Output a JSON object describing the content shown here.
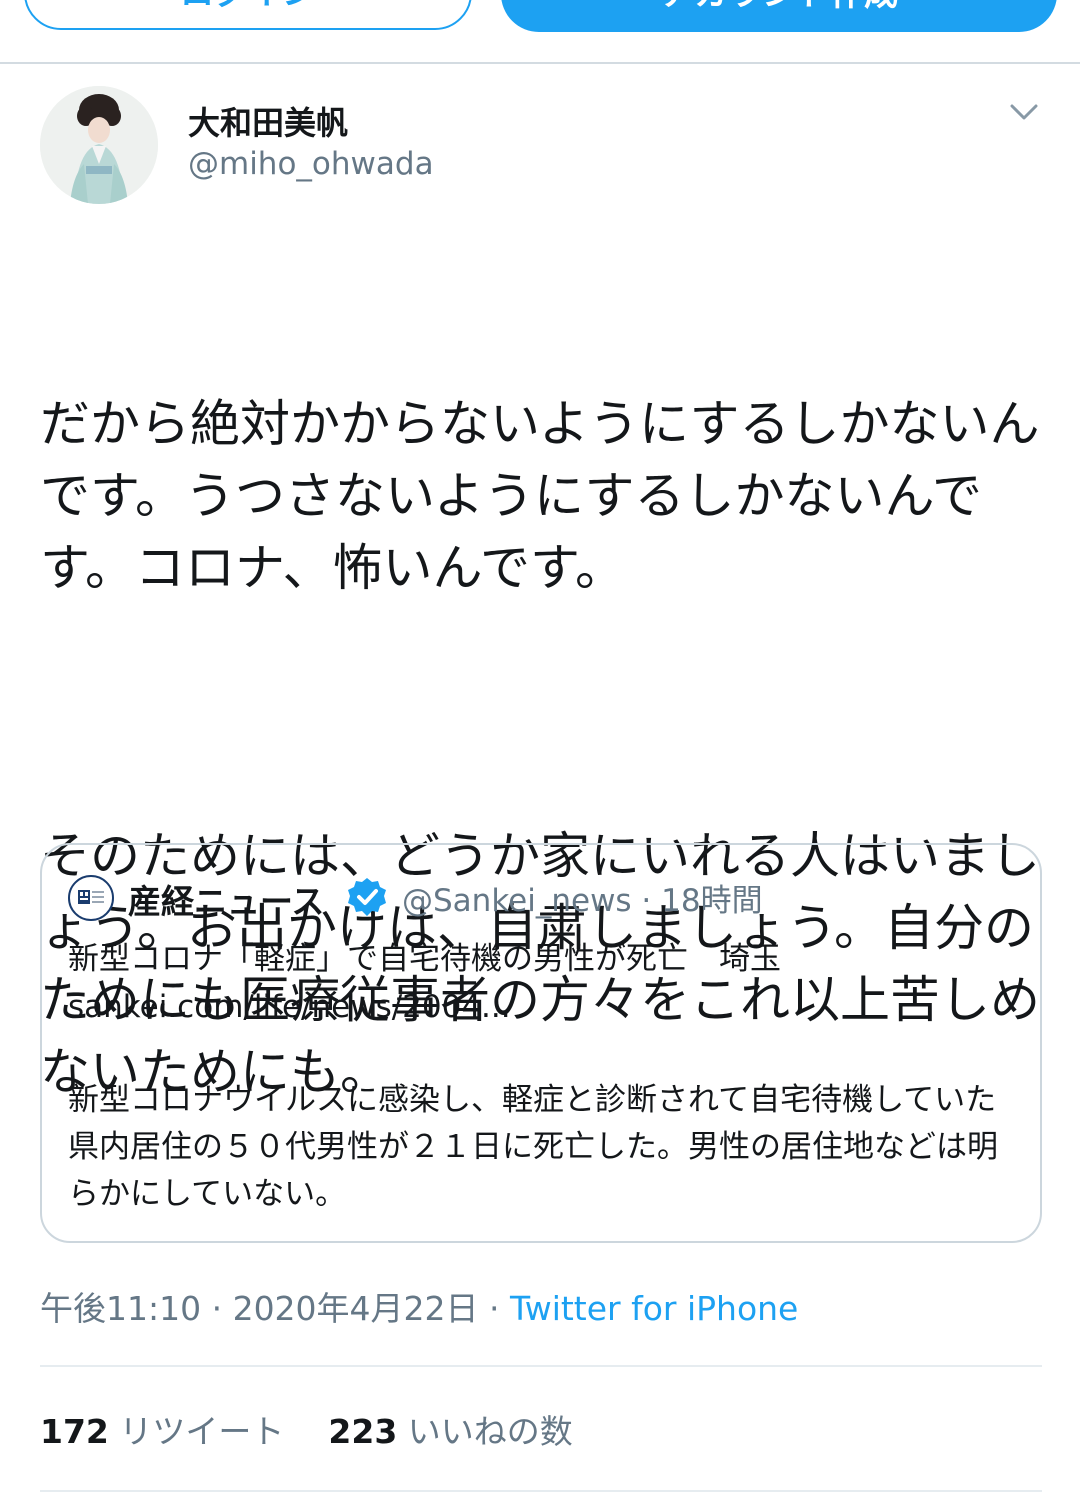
{
  "auth": {
    "login_label": "ログイン",
    "signup_label": "アカウント作成"
  },
  "tweet": {
    "author": {
      "display_name": "大和田美帆",
      "handle": "@miho_ohwada",
      "avatar_icon": "avatar-photo"
    },
    "menu_icon": "chevron-down-icon",
    "paragraphs": [
      "だから絶対かからないようにするしかないんです。うつさないようにするしかないんです。コロナ、怖いんです。",
      "そのためには、どうか家にいれる人はいましょう。お出かけは、自粛しましょう。自分のためにも医療従事者の方々をこれ以上苦しめないためにも。"
    ],
    "quoted": {
      "name": "産経ニュース",
      "verified_icon": "verified-badge-icon",
      "handle_time": "@Sankei_news · 18時間",
      "headline": "新型コロナ「軽症」で自宅待機の男性が死亡　埼玉",
      "url": "sankei.com/life/news/2004...",
      "summary": "新型コロナウイルスに感染し、軽症と診断されて自宅待機していた県内居住の５０代男性が２１日に死亡した。男性の居住地などは明らかにしていない。"
    },
    "timestamp": "午後11:10 · 2020年4月22日 · ",
    "source": "Twitter for iPhone",
    "stats": {
      "retweets_count": "172",
      "retweets_label": " リツイート",
      "likes_count": "223",
      "likes_label": " いいねの数"
    }
  },
  "colors": {
    "accent": "#1da1f2",
    "text": "#14171a",
    "muted": "#657786",
    "border": "#ccd6dd"
  }
}
